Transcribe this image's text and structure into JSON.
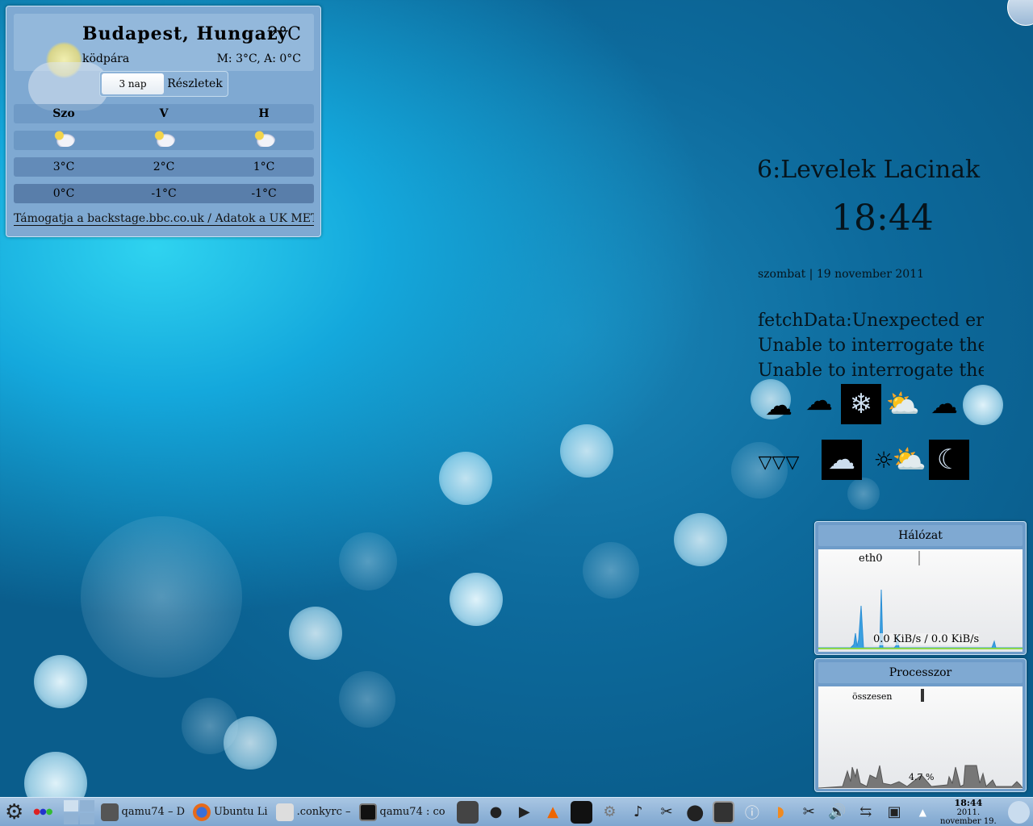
{
  "weather": {
    "city": "Budapest, Hungary",
    "condition": "ködpára",
    "current_temp": "2°C",
    "min_max": "M: 3°C, A: 0°C",
    "tabs": [
      {
        "label": "3 nap",
        "active": true
      },
      {
        "label": "Részletek",
        "active": false
      }
    ],
    "days": [
      "Szo",
      "V",
      "H"
    ],
    "icons": [
      "partly-cloudy-icon",
      "partly-cloudy-icon",
      "partly-cloudy-icon"
    ],
    "highs": [
      "3°C",
      "2°C",
      "1°C"
    ],
    "lows": [
      "0°C",
      "-1°C",
      "-1°C"
    ],
    "credit": "Támogatja a backstage.bbc.co.uk / Adatok a UK MET Office-tól"
  },
  "conky": {
    "mail": "6:Levelek Lacinak",
    "time": "18:44",
    "date": "szombat | 19 november 2011",
    "errors": [
      "fetchData:Unexpected error: <t",
      "Unable to interrogate the weat",
      "Unable to interrogate the weat"
    ]
  },
  "network": {
    "title": "Hálózat",
    "interface": "eth0",
    "rate": "0.0 KiB/s / 0.0 KiB/s"
  },
  "cpu": {
    "title": "Processzor",
    "label": "összesen",
    "value": "4.7 %"
  },
  "taskbar": {
    "tasks": [
      {
        "label": "qamu74 – D",
        "icon": "file-manager-icon"
      },
      {
        "label": "Ubuntu Li",
        "icon": "firefox-icon"
      },
      {
        "label": ".conkyrc –",
        "icon": "text-editor-icon"
      },
      {
        "label": "qamu74 : co",
        "icon": "terminal-icon"
      }
    ],
    "clock_time": "18:44",
    "clock_date": "2011. november 19."
  }
}
